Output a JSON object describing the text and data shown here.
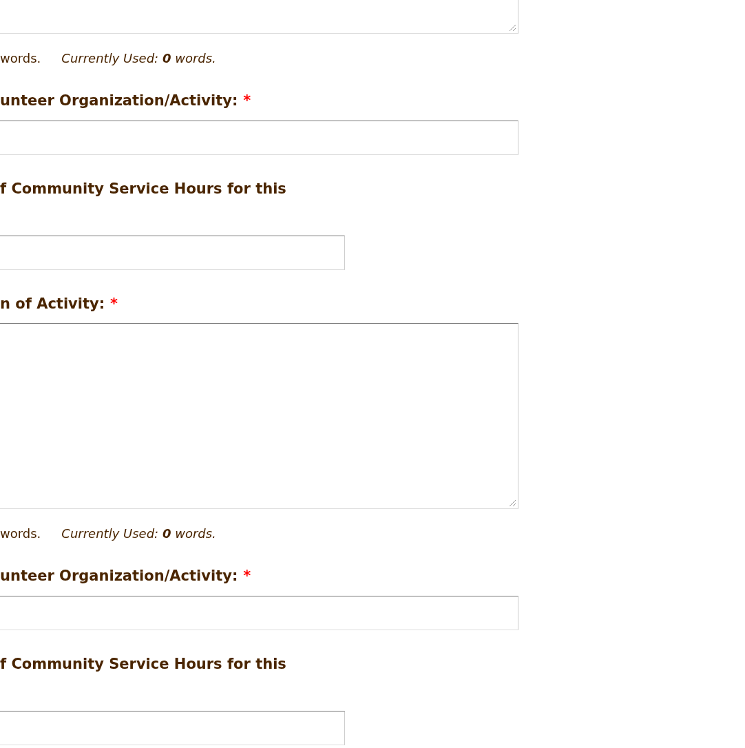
{
  "items": [
    {
      "kind": "textarea_end"
    },
    {
      "kind": "note",
      "limit": "words.",
      "used": "*Currently Used:* **0** *words.*"
    },
    {
      "kind": "label",
      "text": "unteer Organization/Activity:",
      "mark": "*"
    },
    {
      "kind": "input"
    },
    {
      "kind": "label",
      "text": "f Community Service Hours for this"
    },
    {
      "kind": "short_input"
    },
    {
      "kind": "label",
      "text": "n of Activity:",
      "mark": "*"
    },
    {
      "kind": "textarea"
    },
    {
      "kind": "note",
      "limit": "words.",
      "used": "*Currently Used:* **0** *words.*"
    },
    {
      "kind": "label",
      "text": "unteer Organization/Activity:",
      "mark": "*"
    },
    {
      "kind": "input"
    },
    {
      "kind": "label",
      "text": "f Community Service Hours for this"
    },
    {
      "kind": "short_input"
    }
  ]
}
